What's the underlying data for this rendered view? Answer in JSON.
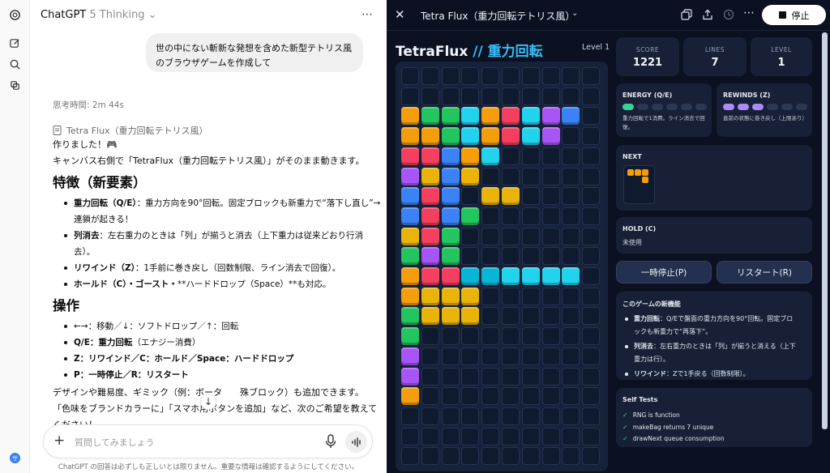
{
  "chat": {
    "model_name": "ChatGPT",
    "model_version": "5 Thinking",
    "user_message": "世の中にない斬新な発想を含めた新型テトリス風のブラウザゲームを作成して",
    "thinking_time": "思考時間: 2m 44s",
    "canvas_ref": "Tetra Flux（重力回転テトリス風）",
    "intro_line1": "作りました！🎮",
    "intro_line2": "キャンバス右側で「TetraFlux（重力回転テトリス風）」がそのまま動きます。",
    "features_heading": "特徴（新要素）",
    "features": [
      {
        "bold": "重力回転（Q/E）",
        "text": "：重力方向を90°回転。固定ブロックも新重力で“落下し直し”→ 連鎖が起きる！"
      },
      {
        "bold": "列消去",
        "text": "：左右重力のときは「列」が揃うと消去（上下重力は従来どおり行消去）。"
      },
      {
        "bold": "リワインド（Z）",
        "text": "：1手前に巻き戻し（回数制限、ライン消去で回復）。"
      },
      {
        "bold": "ホールド（C）・ゴースト・",
        "text": "**ハードドロップ（Space）**も対応。"
      }
    ],
    "controls_heading": "操作",
    "controls": [
      {
        "bold": "",
        "text": "←→：移動／↓：ソフトドロップ／↑：回転"
      },
      {
        "bold": "Q/E：重力回転",
        "text": "（エナジー消費）"
      },
      {
        "bold": "Z：リワインド／C：ホールド／Space：ハードドロップ",
        "text": ""
      },
      {
        "bold": "P：一時停止／R：リスタート",
        "text": ""
      }
    ],
    "outro_line1": "デザインや難易度、ギミック（例：ボータ　　殊ブロック）も追加できます。",
    "outro_line2": "「色味をブランドカラーに」「スマホ用ボタンを追加」など、次のご希望を教えてください！",
    "input_placeholder": "質問してみましょう",
    "disclaimer": "ChatGPT の回答は必ずしも正しいとは限りません。重要な情報は確認するようにしてください。"
  },
  "canvas": {
    "title": "Tetra Flux（重力回転テトリス風）",
    "stop_label": "停止",
    "game_title_main": "TetraFlux",
    "game_title_sep": " // ",
    "game_title_sub": "重力回転",
    "level_tag": "Level 1",
    "stats": [
      {
        "label": "SCORE",
        "value": "1221"
      },
      {
        "label": "LINES",
        "value": "7"
      },
      {
        "label": "LEVEL",
        "value": "1"
      }
    ],
    "energy": {
      "title": "ENERGY (Q/E)",
      "filled": 1,
      "total": 6,
      "desc": "重力回転で1消費。ライン消去で回復。",
      "color": "#34d399"
    },
    "rewinds": {
      "title": "REWINDS (Z)",
      "filled": 3,
      "total": 6,
      "desc": "直前の状態に巻き戻し（上限あり）",
      "color": "#a78bfa"
    },
    "next_title": "NEXT",
    "hold_title": "HOLD (C)",
    "hold_value": "未使用",
    "pause_label": "一時停止(P)",
    "restart_label": "リスタート(R)",
    "new_features_title": "このゲームの新機能",
    "new_features": [
      {
        "bold": "重力回転",
        "text": "：Q/Eで盤面の重力方向を90°回転。固定ブロックも新重力で“再落下”。"
      },
      {
        "bold": "列消去",
        "text": "：左右重力のときは「列」が揃うと消える（上下重力は行）。"
      },
      {
        "bold": "リワインド",
        "text": "：Zで1手戻る（回数制限）。"
      }
    ],
    "tests_title": "Self Tests",
    "tests": [
      "RNG is function",
      "makeBag returns 7 unique",
      "drawNext queue consumption"
    ],
    "board": {
      "cols": 10,
      "rows": 20,
      "palette": {
        "O": "#f59e0b",
        "G": "#22c55e",
        "R": "#f43f5e",
        "C": "#22d3ee",
        "P": "#a855f7",
        "B": "#3b82f6",
        "Y": "#eab308",
        "T": "#06b6d4"
      },
      "grid": [
        "..........",
        "..........",
        "OGGCORCPB.",
        "OOGCORCP..",
        "RRBOC.....",
        "PYBY......",
        "BRB.YY....",
        "BRBG......",
        "YRG.......",
        "GPG.......",
        "ORRTTCCCC.",
        "OYYY......",
        "GYYY......",
        "G.........",
        "P.........",
        "P.........",
        "O.........",
        "..........",
        "..........",
        ".........."
      ]
    },
    "next_piece": {
      "cells": [
        [
          0,
          0
        ],
        [
          1,
          0
        ],
        [
          2,
          0
        ],
        [
          2,
          1
        ]
      ],
      "color": "#f59e0b"
    }
  }
}
